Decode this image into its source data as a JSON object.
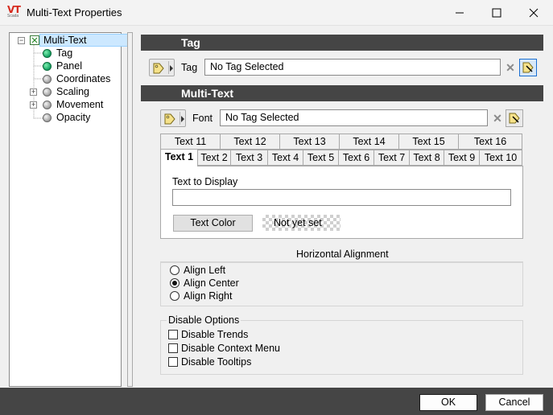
{
  "window": {
    "title": "Multi-Text Properties",
    "logo_text": "VT",
    "logo_sub": "Scada"
  },
  "tree": {
    "root": "Multi-Text",
    "items": [
      "Tag",
      "Panel",
      "Coordinates",
      "Scaling",
      "Movement",
      "Opacity"
    ]
  },
  "tag_section": {
    "header": "Tag",
    "label": "Tag",
    "value": "No Tag Selected"
  },
  "multitext_section": {
    "header": "Multi-Text",
    "font_label": "Font",
    "font_value": "No Tag Selected",
    "tabs_row1": [
      "Text 11",
      "Text 12",
      "Text 13",
      "Text 14",
      "Text 15",
      "Text 16"
    ],
    "tabs_row2": [
      "Text 1",
      "Text 2",
      "Text 3",
      "Text 4",
      "Text 5",
      "Text 6",
      "Text 7",
      "Text 8",
      "Text 9",
      "Text 10"
    ],
    "active_tab": "Text 1",
    "text_to_display_label": "Text to Display",
    "text_to_display_value": "",
    "text_color_button": "Text Color",
    "color_status": "Not yet set"
  },
  "alignment": {
    "title": "Horizontal Alignment",
    "options": [
      "Align Left",
      "Align Center",
      "Align Right"
    ],
    "selected": "Align Center"
  },
  "disable_options": {
    "title": "Disable Options",
    "options": [
      "Disable Trends",
      "Disable Context Menu",
      "Disable Tooltips"
    ]
  },
  "footer": {
    "ok": "OK",
    "cancel": "Cancel"
  },
  "colors": {
    "header_bg": "#454545",
    "accent": "#1a6fd1",
    "logo_red": "#d62b1f"
  }
}
